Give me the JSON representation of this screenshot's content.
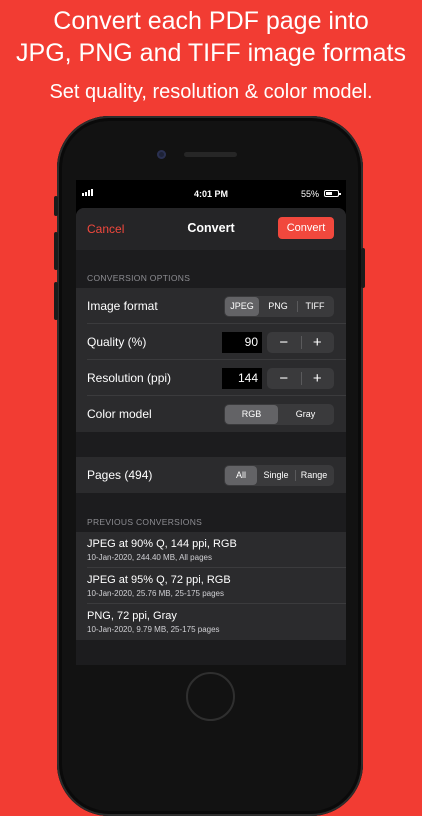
{
  "headline": {
    "line1": "Convert each PDF page into",
    "line2": "JPG, PNG and TIFF image formats",
    "line3": "Set quality, resolution & color model."
  },
  "status_bar": {
    "time": "4:01 PM",
    "battery_text": "55%",
    "battery_level": 0.55
  },
  "nav": {
    "cancel": "Cancel",
    "title": "Convert",
    "convert": "Convert"
  },
  "conversion_options": {
    "header": "CONVERSION OPTIONS",
    "image_format": {
      "label": "Image format",
      "options": [
        "JPEG",
        "PNG",
        "TIFF"
      ],
      "selected": "JPEG"
    },
    "quality": {
      "label": "Quality (%)",
      "value": "90",
      "minus": "−",
      "plus": "+"
    },
    "resolution": {
      "label": "Resolution (ppi)",
      "value": "144",
      "minus": "−",
      "plus": "+"
    },
    "color_model": {
      "label": "Color model",
      "options": [
        "RGB",
        "Gray"
      ],
      "selected": "RGB"
    }
  },
  "pages": {
    "label": "Pages (494)",
    "options": [
      "All",
      "Single",
      "Range"
    ],
    "selected": "All"
  },
  "previous_conversions": {
    "header": "PREVIOUS CONVERSIONS",
    "items": [
      {
        "title": "JPEG at 90% Q, 144 ppi, RGB",
        "detail": "10-Jan-2020, 244.40 MB, All pages"
      },
      {
        "title": "JPEG at 95% Q, 72 ppi, RGB",
        "detail": "10-Jan-2020, 25.76 MB, 25-175 pages"
      },
      {
        "title": "PNG, 72 ppi, Gray",
        "detail": "10-Jan-2020, 9.79 MB, 25-175 pages"
      }
    ]
  },
  "colors": {
    "background": "#f23c33",
    "accent": "#f1483d",
    "sheet": "#1c1c1e",
    "row": "#2b2b2d"
  }
}
